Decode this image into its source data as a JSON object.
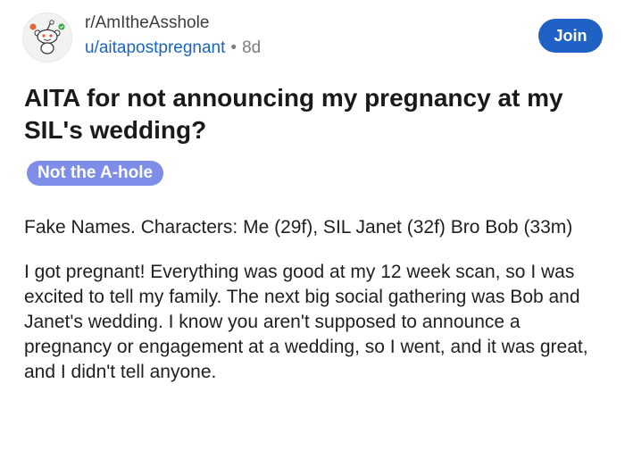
{
  "post": {
    "subreddit": "r/AmItheAsshole",
    "username": "u/aitapostpregnant",
    "separator": "•",
    "age": "8d",
    "join_label": "Join",
    "title": "AITA for not announcing my pregnancy at my SIL's wedding?",
    "flair": "Not the A-hole",
    "paragraphs": [
      "Fake Names. Characters: Me (29f), SIL Janet (32f) Bro Bob (33m)",
      "I got pregnant! Everything was good at my 12 week scan, so I was excited to tell my family. The next big social gathering was Bob and Janet's wedding. I know you aren't supposed to announce a pregnancy or engagement at a wedding, so I went, and it was great, and I didn't tell anyone."
    ]
  },
  "colors": {
    "join_bg": "#1f61c4",
    "flair_bg": "#7d8de8",
    "username": "#1a64c2"
  },
  "icons": {
    "avatar": "snoo-avatar-icon"
  }
}
